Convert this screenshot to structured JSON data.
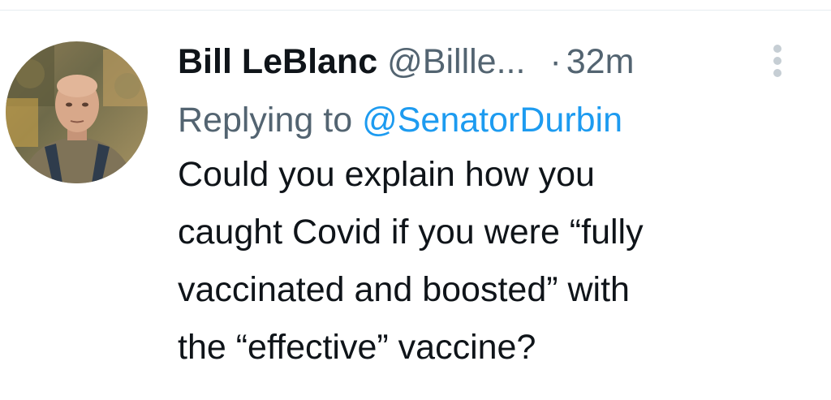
{
  "tweet": {
    "author_name": "Bill LeBlanc",
    "author_handle": "@Billle...",
    "separator": "·",
    "timestamp": "32m",
    "replying_prefix": "Replying to",
    "replying_to": "@SenatorDurbin",
    "text_lines": [
      "Could you explain how you",
      "caught Covid if you were “fully",
      "vaccinated and boosted” with",
      "the “effective” vaccine?"
    ]
  },
  "icons": {
    "more": "more-vertical-icon",
    "avatar": "profile-photo"
  },
  "colors": {
    "name": "#0f1419",
    "secondary": "#536471",
    "link": "#1d9bf0",
    "more_icon": "#c6ced4"
  }
}
